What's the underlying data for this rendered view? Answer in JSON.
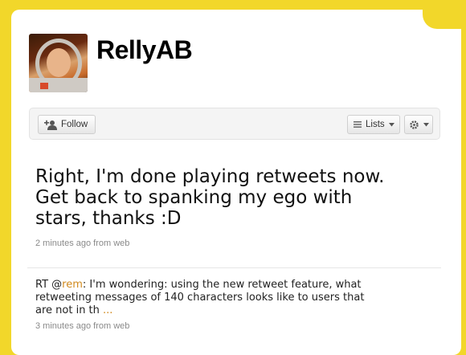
{
  "profile": {
    "screen_name": "RellyAB"
  },
  "actions": {
    "follow_label": "Follow",
    "lists_label": "Lists",
    "follow_icon": "add-user-icon",
    "lists_icon": "list-icon",
    "settings_icon": "gear-icon"
  },
  "tweets": [
    {
      "text": "Right, I'm done playing retweets now. Get back to spanking my ego with stars, thanks :D",
      "time": "2 minutes ago",
      "from_word": "from",
      "source": "web"
    },
    {
      "prefix": "RT @",
      "mention": "rem",
      "text": ": I'm wondering: using the new retweet feature, what retweeting messages of 140 characters looks like to users that are not in th ",
      "more": "...",
      "time": "3 minutes ago",
      "from_word": "from",
      "source": "web"
    }
  ],
  "colors": {
    "background": "#f2d72a",
    "link": "#d18a1d",
    "meta_text": "#8a8a8a"
  }
}
